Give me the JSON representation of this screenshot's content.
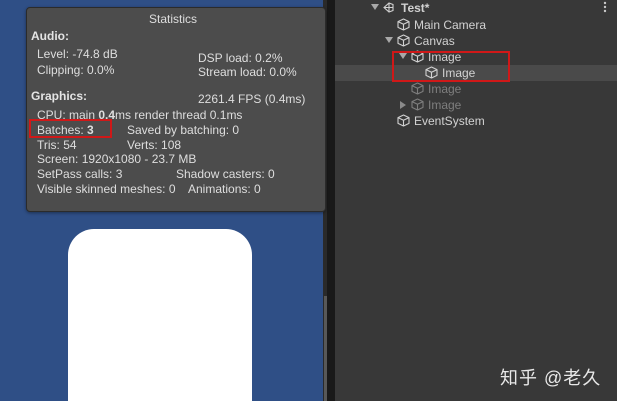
{
  "stats": {
    "title": "Statistics",
    "audio_heading": "Audio:",
    "level": "Level: -74.8 dB",
    "dsp_load": "DSP load: 0.2%",
    "clipping": "Clipping: 0.0%",
    "stream_load": "Stream load: 0.0%",
    "graphics_heading": "Graphics:",
    "fps": "2261.4 FPS (0.4ms)",
    "cpu_prefix": "CPU: main ",
    "cpu_main": "0.4",
    "cpu_suffix": "ms  render thread 0.1ms",
    "batches_label": "Batches: ",
    "batches_value": "3",
    "saved_by_batching": "Saved by batching: 0",
    "tris": "Tris: 54",
    "verts": "Verts: 108",
    "screen": "Screen: 1920x1080 - 23.7 MB",
    "setpass": "SetPass calls: 3",
    "shadow_casters": "Shadow casters: 0",
    "skinned": "Visible skinned meshes: 0",
    "animations": "Animations: 0"
  },
  "hierarchy": {
    "scene_name": "Test*",
    "more_icon": "vertical-ellipsis-icon",
    "items": [
      {
        "label": "Main Camera",
        "icon": "gameobject-cube-icon",
        "state": "normal"
      },
      {
        "label": "Canvas",
        "icon": "gameobject-cube-icon",
        "state": "expanded"
      },
      {
        "label": "Image",
        "icon": "gameobject-cube-icon",
        "state": "expanded"
      },
      {
        "label": "Image",
        "icon": "gameobject-cube-icon",
        "state": "selected"
      },
      {
        "label": "Image",
        "icon": "gameobject-cube-icon",
        "state": "disabled"
      },
      {
        "label": "Image",
        "icon": "gameobject-cube-icon",
        "state": "disabled-collapsed"
      },
      {
        "label": "EventSystem",
        "icon": "gameobject-cube-icon",
        "state": "normal"
      }
    ]
  },
  "colors": {
    "game_view_bg": "#2f4f86",
    "panel_bg": "#383838",
    "stats_bg": "#4c4c4c",
    "highlight_box": "#d01818"
  },
  "watermark": "知乎 @老久"
}
